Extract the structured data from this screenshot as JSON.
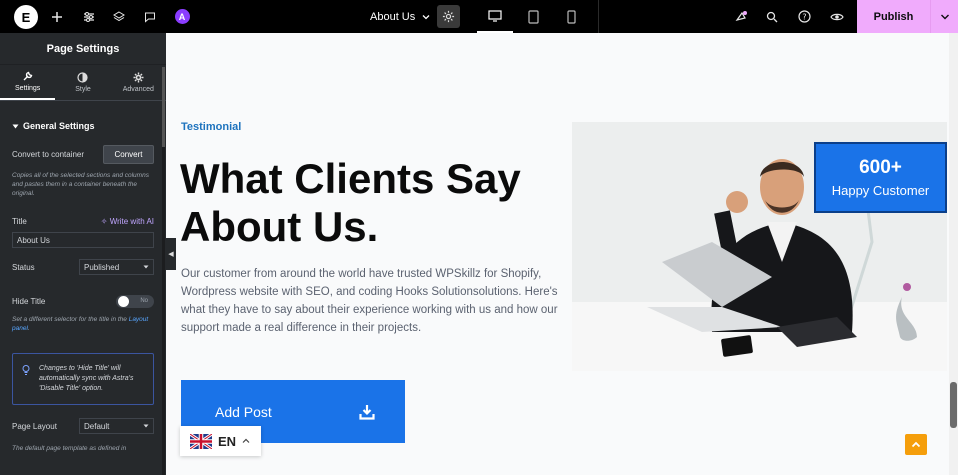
{
  "topbar": {
    "page_name": "About Us",
    "publish_label": "Publish",
    "icons": [
      "elementor-logo-icon",
      "plus-icon",
      "sliders-icon",
      "layers-icon",
      "comment-icon",
      "ai-icon",
      "settings-gear-icon",
      "desktop-icon",
      "tablet-icon",
      "mobile-icon",
      "notifications-icon",
      "search-icon",
      "help-icon",
      "preview-eye-icon"
    ]
  },
  "sidebar": {
    "title": "Page Settings",
    "tabs": [
      {
        "label": "Settings",
        "icon": "wrench-icon",
        "active": true
      },
      {
        "label": "Style",
        "icon": "half-circle-icon",
        "active": false
      },
      {
        "label": "Advanced",
        "icon": "gear-icon",
        "active": false
      }
    ],
    "section_title": "General Settings",
    "convert_label": "Convert to container",
    "convert_button": "Convert",
    "convert_hint": "Copies all of the selected sections and columns and pastes them in a container beneath the original.",
    "title_label": "Title",
    "write_ai": "Write with AI",
    "title_value": "About Us",
    "status_label": "Status",
    "status_value": "Published",
    "hide_title_label": "Hide Title",
    "hide_title_toggle": "No",
    "hide_hint_pre": "Set a different selector for the title in the ",
    "hide_hint_link": "Layout panel",
    "hide_hint_post": ".",
    "notice": "Changes to 'Hide Title' will automatically sync with Astra's 'Disable Title' option.",
    "page_layout_label": "Page Layout",
    "page_layout_value": "Default",
    "layout_hint": "The default page template as defined in"
  },
  "content": {
    "subtitle": "Testimonial",
    "headline": "What Clients Say About Us.",
    "paragraph": "Our customer from around the world have trusted WPSkillz for  Shopify, Wordpress website with SEO, and coding Hooks Solutionsolutions. Here's what they have to say about their experience working with us and how our support made a real difference in their projects.",
    "button": "Add Post",
    "badge_number": "600+",
    "badge_caption": "Happy Customer"
  },
  "language": {
    "code": "EN"
  },
  "colors": {
    "accent": "#1a73e8",
    "publish": "#f0abfc",
    "sidebar_bg": "#26292c",
    "scroll_top": "#f59e0b"
  }
}
